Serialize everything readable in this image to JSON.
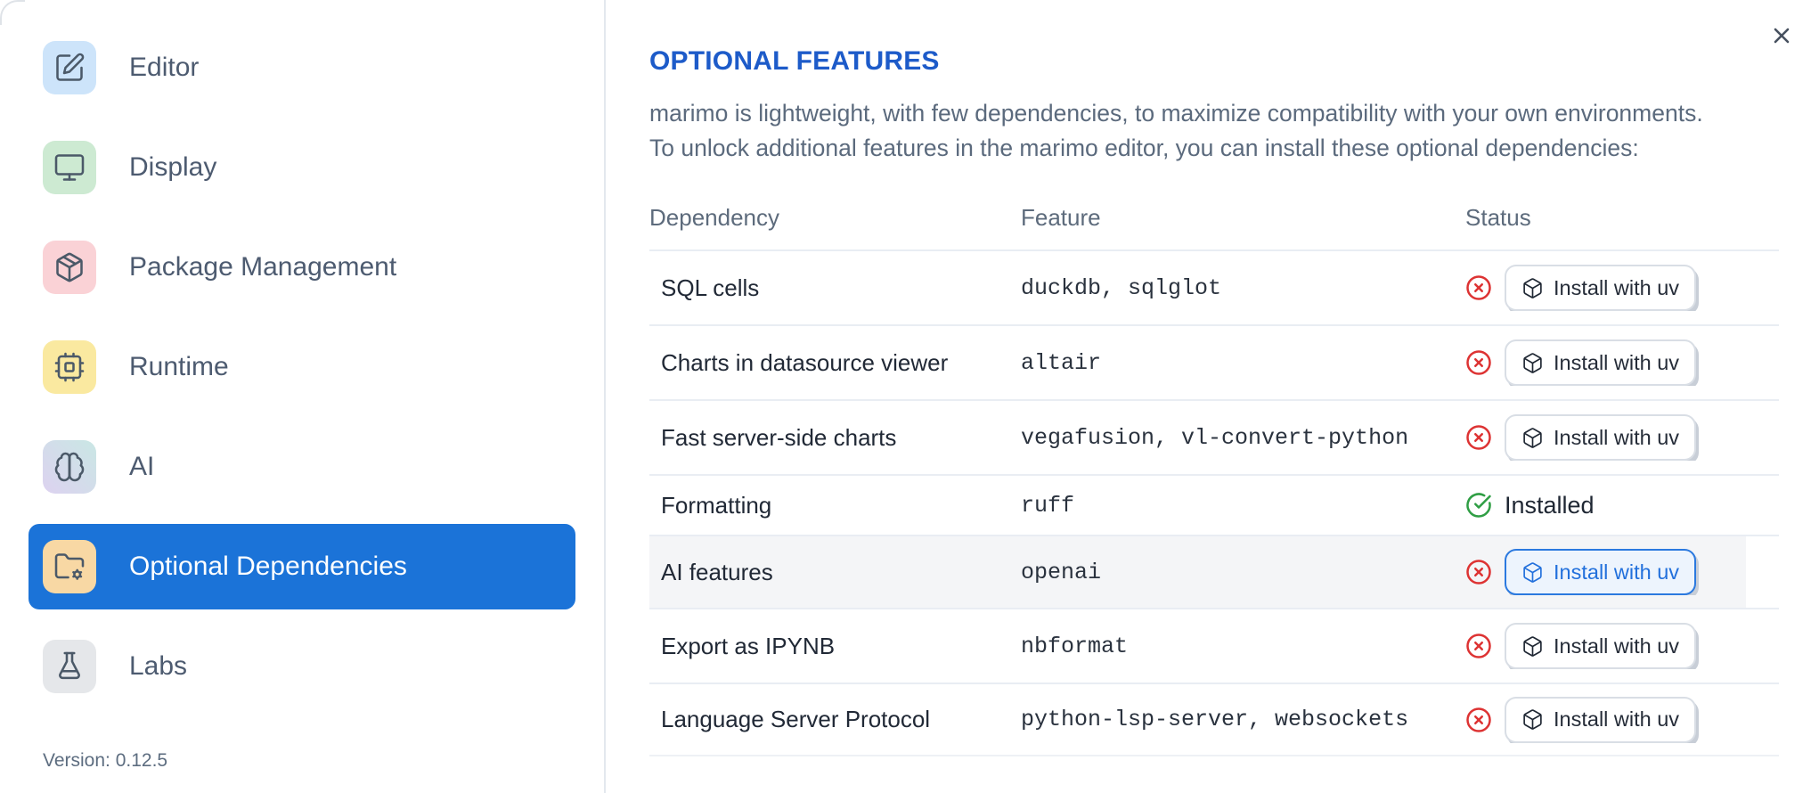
{
  "sidebar": {
    "items": [
      {
        "label": "Editor",
        "icon": "editor-icon",
        "icon_bg": "#cde4fa",
        "selected": false
      },
      {
        "label": "Display",
        "icon": "display-icon",
        "icon_bg": "#cdead2",
        "selected": false
      },
      {
        "label": "Package Management",
        "icon": "package-icon",
        "icon_bg": "#fad2d6",
        "selected": false
      },
      {
        "label": "Runtime",
        "icon": "cpu-icon",
        "icon_bg": "#fae9a0",
        "selected": false
      },
      {
        "label": "AI",
        "icon": "brain-icon",
        "icon_bg": "linear-gradient(to top right,#ddd2f0,#c9e7e4)",
        "selected": false
      },
      {
        "label": "Optional Dependencies",
        "icon": "folder-gear-icon",
        "icon_bg": "#f8d8a4",
        "selected": true
      },
      {
        "label": "Labs",
        "icon": "flask-icon",
        "icon_bg": "#e5e7ea",
        "selected": false
      }
    ],
    "version_label": "Version: 0.12.5"
  },
  "main": {
    "title": "OPTIONAL FEATURES",
    "intro_line1": "marimo is lightweight, with few dependencies, to maximize compatibility with your own environments.",
    "intro_line2": "To unlock additional features in the marimo editor, you can install these optional dependencies:",
    "table": {
      "columns": [
        "Dependency",
        "Feature",
        "Status"
      ],
      "installed_label": "Installed",
      "install_button_label": "Install with uv",
      "rows": [
        {
          "dependency": "SQL cells",
          "feature": "duckdb, sqlglot",
          "installed": false,
          "highlighted": false
        },
        {
          "dependency": "Charts in datasource viewer",
          "feature": "altair",
          "installed": false,
          "highlighted": false
        },
        {
          "dependency": "Fast server-side charts",
          "feature": "vegafusion, vl-convert-python",
          "installed": false,
          "highlighted": false
        },
        {
          "dependency": "Formatting",
          "feature": "ruff",
          "installed": true,
          "highlighted": false
        },
        {
          "dependency": "AI features",
          "feature": "openai",
          "installed": false,
          "highlighted": true
        },
        {
          "dependency": "Export as IPYNB",
          "feature": "nbformat",
          "installed": false,
          "highlighted": false
        },
        {
          "dependency": "Language Server Protocol",
          "feature": "python-lsp-server, websockets",
          "installed": false,
          "highlighted": false
        }
      ]
    }
  },
  "colors": {
    "accent_blue": "#1b73d8",
    "heading_blue": "#1d5bc9",
    "error_red": "#dd3333",
    "success_green": "#2f9e44",
    "focus_blue": "#2b79df"
  }
}
